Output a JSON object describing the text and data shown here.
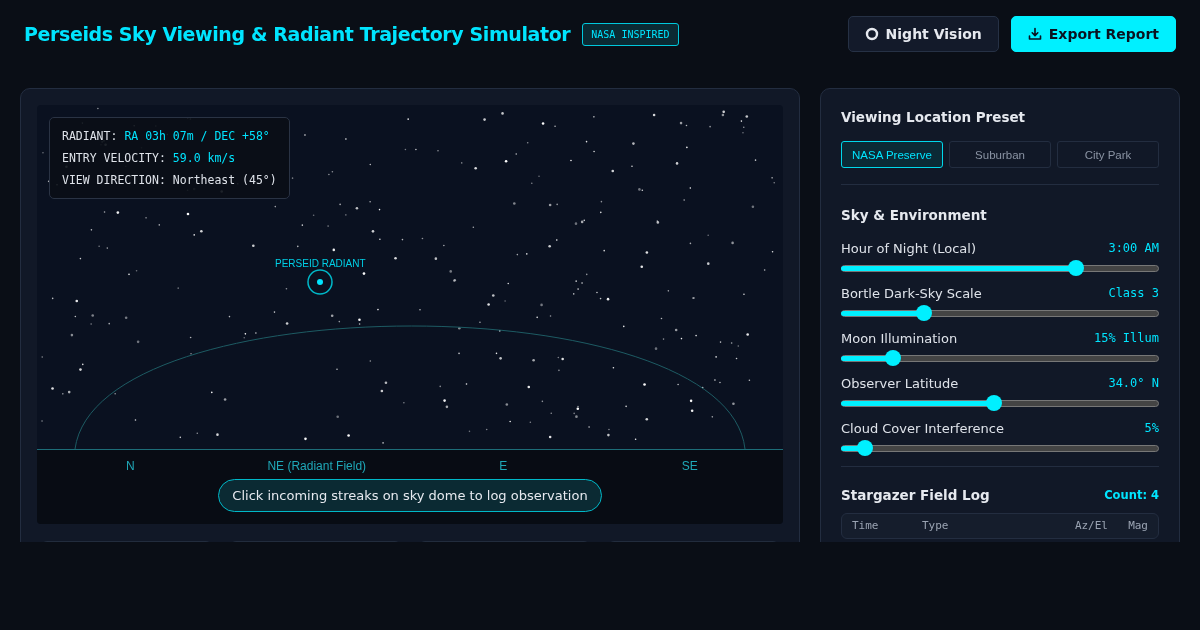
{
  "header": {
    "title": "Perseids Sky Viewing & Radiant Trajectory Simulator",
    "badge": "NASA INSPIRED",
    "buttons": [
      {
        "kind": "toggle",
        "label": "Night Vision"
      },
      {
        "kind": "export",
        "label": "Export Report"
      }
    ]
  },
  "sky": {
    "info": [
      {
        "label": "RADIANT:",
        "value": "RA 03h 07m / DEC +58°",
        "highlight": true
      },
      {
        "label": "ENTRY VELOCITY:",
        "value": "59.0 km/s",
        "highlight": true
      },
      {
        "label": "VIEW DIRECTION:",
        "value": "Northeast (45°)",
        "highlight": false
      }
    ],
    "radiant_label": "PERSEID RADIANT",
    "directions": [
      "N",
      "NE (Radiant Field)",
      "E",
      "SE"
    ],
    "hint": "Click incoming streaks on sky dome to log observation"
  },
  "location": {
    "title": "Viewing Location Preset",
    "presets": [
      {
        "label": "NASA Preserve",
        "selected": true
      },
      {
        "label": "Suburban",
        "selected": false
      },
      {
        "label": "City Park",
        "selected": false
      }
    ]
  },
  "environment": {
    "title": "Sky & Environment",
    "sliders": [
      {
        "label": "Hour of Night (Local)",
        "reading": "3:00 AM",
        "level": 0.74
      },
      {
        "label": "Bortle Dark-Sky Scale",
        "reading": "Class 3",
        "level": 0.26
      },
      {
        "label": "Moon Illumination",
        "reading": "15% Illum",
        "level": 0.165
      },
      {
        "label": "Observer Latitude",
        "reading": "34.0° N",
        "level": 0.48
      },
      {
        "label": "Cloud Cover Interference",
        "reading": "5%",
        "level": 0.076
      }
    ]
  },
  "log": {
    "title": "Stargazer Field Log",
    "count": "Count: 4",
    "columns": [
      "Time",
      "Type",
      "Az/El",
      "Mag"
    ]
  }
}
